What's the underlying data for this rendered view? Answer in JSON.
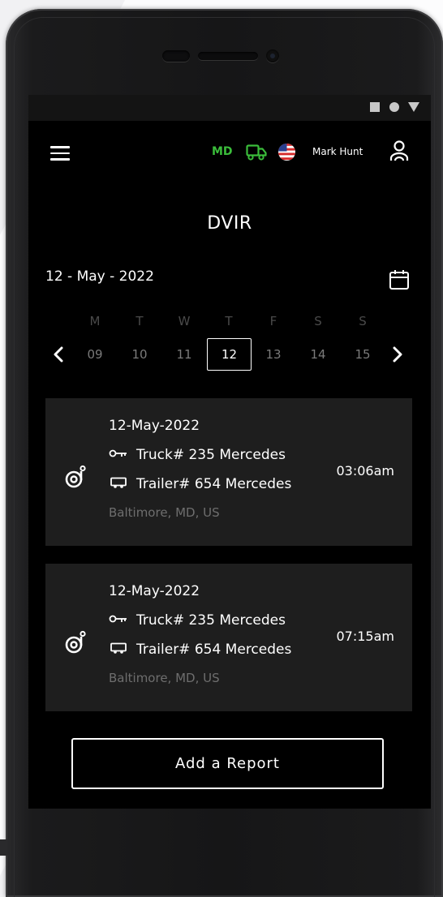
{
  "header": {
    "state_code": "MD",
    "user_name": "Mark Hunt",
    "state_color": "#3bbd3b"
  },
  "page": {
    "title": "DVIR"
  },
  "date_picker": {
    "current_date": "12 - May - 2022",
    "weekdays": [
      "M",
      "T",
      "W",
      "T",
      "F",
      "S",
      "S"
    ],
    "days": [
      "09",
      "10",
      "11",
      "12",
      "13",
      "14",
      "15"
    ],
    "selected_day": "12"
  },
  "reports": [
    {
      "date": "12-May-2022",
      "truck": "Truck# 235 Mercedes",
      "trailer": "Trailer# 654 Mercedes",
      "location": "Baltimore, MD, US",
      "time": "03:06am"
    },
    {
      "date": "12-May-2022",
      "truck": "Truck# 235 Mercedes",
      "trailer": "Trailer# 654 Mercedes",
      "location": "Baltimore, MD, US",
      "time": "07:15am"
    }
  ],
  "actions": {
    "add_report_label": "Add a Report"
  },
  "icons": {
    "menu": "hamburger-menu-icon",
    "truck": "truck-icon",
    "flag": "us-flag-icon",
    "user": "user-icon",
    "calendar": "calendar-icon",
    "report": "tire-gauge-icon"
  }
}
